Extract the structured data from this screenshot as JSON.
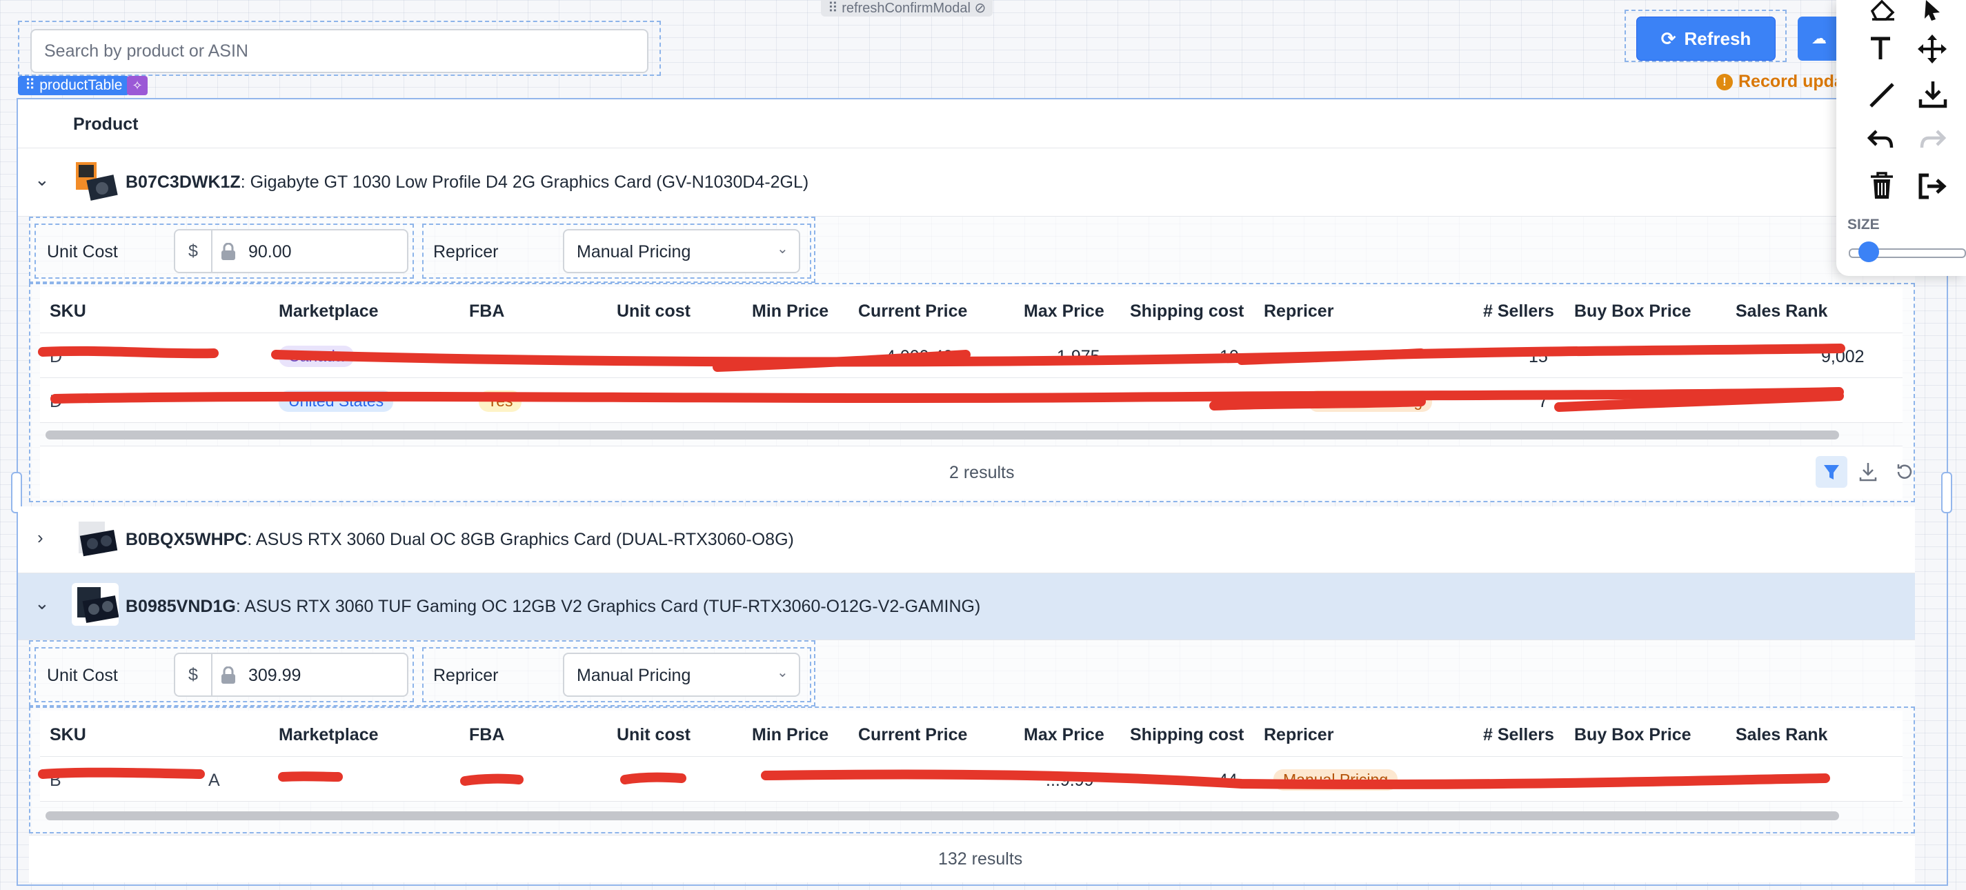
{
  "search": {
    "placeholder": "Search by product or ASIN"
  },
  "modal_tag": "refreshConfirmModal",
  "table_tag": "productTable",
  "toolbar": {
    "refresh_label": "Refresh",
    "record_update": "Record upda"
  },
  "table": {
    "header_product": "Product",
    "products": [
      {
        "asin": "B07C3DWK1Z",
        "title": ": Gigabyte GT 1030 Low Profile D4 2G Graphics Card (GV-N1030D4-2GL)",
        "unit_cost_label": "Unit Cost",
        "currency": "$",
        "unit_cost": "90.00",
        "repricer_label": "Repricer",
        "repricer_value": "Manual Pricing",
        "results": "2 results"
      },
      {
        "asin": "B0BQX5WHPC",
        "title": ": ASUS RTX 3060 Dual OC 8GB Graphics Card (DUAL-RTX3060-O8G)"
      },
      {
        "asin": "B0985VND1G",
        "title": ": ASUS RTX 3060 TUF Gaming OC 12GB V2 Graphics Card (TUF-RTX3060-O12G-V2-GAMING)",
        "unit_cost_label": "Unit Cost",
        "currency": "$",
        "unit_cost": "309.99",
        "repricer_label": "Repricer",
        "repricer_value": "Manual Pricing"
      }
    ],
    "inner_columns": [
      "SKU",
      "Marketplace",
      "FBA",
      "Unit cost",
      "Min Price",
      "Current Price",
      "Max Price",
      "Shipping cost",
      "Repricer",
      "# Sellers",
      "Buy Box Price",
      "Sales Rank"
    ],
    "total_results": "132 results",
    "visible_row_fragments": {
      "p1r1": {
        "sku": "D",
        "marketplace": "Canada",
        "current": "4,000.40",
        "max": "1,975",
        "shipping": "10",
        "sellers": "15",
        "rank": "9,002"
      },
      "p1r2": {
        "sku": "D",
        "marketplace": "United States",
        "fba": "Yes",
        "repricer": "Manual Pricing",
        "sellers": "7"
      },
      "p3r1": {
        "sku": "B",
        "suffix": "A",
        "max": "...9.99",
        "shipping": "44",
        "repricer": "Manual Pricing"
      }
    }
  },
  "draw_panel": {
    "size_label": "SIZE",
    "size_value": 0.1
  },
  "colors": {
    "accent": "#3b82f6",
    "warning": "#d97706",
    "redaction": "#e5362a",
    "selected_row": "#dbe7f6"
  }
}
